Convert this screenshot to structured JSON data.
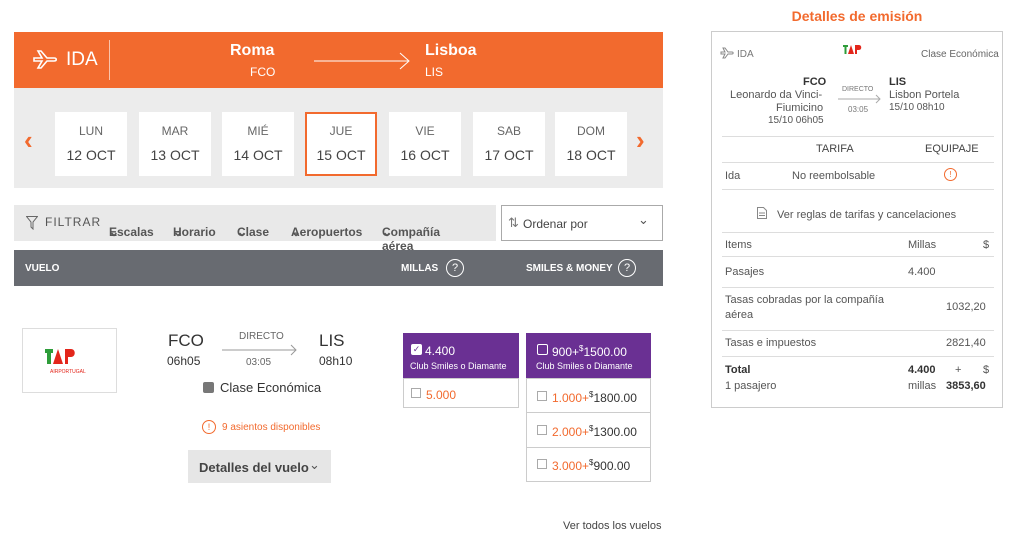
{
  "colors": {
    "accent": "#f26a2e",
    "purple": "#6a3093",
    "header_gray": "#686b71"
  },
  "ida": {
    "label": "IDA",
    "origin_city": "Roma",
    "origin_code": "FCO",
    "dest_city": "Lisboa",
    "dest_code": "LIS"
  },
  "days": [
    {
      "name": "LUN",
      "date": "12 OCT"
    },
    {
      "name": "MAR",
      "date": "13 OCT"
    },
    {
      "name": "MIÉ",
      "date": "14 OCT"
    },
    {
      "name": "JUE",
      "date": "15 OCT"
    },
    {
      "name": "VIE",
      "date": "16 OCT"
    },
    {
      "name": "SAB",
      "date": "17 OCT"
    },
    {
      "name": "DOM",
      "date": "18 OCT"
    }
  ],
  "filters": {
    "label": "FILTRAR",
    "items": [
      "Escalas",
      "Horario",
      "Clase",
      "Aeropuertos",
      "Compañía aérea"
    ]
  },
  "sort": {
    "label": "Ordenar por"
  },
  "table_header": {
    "vuelo": "VUELO",
    "millas": "MILLAS",
    "smiles": "SMILES & MONEY",
    "help": "?"
  },
  "flight": {
    "origin": "FCO",
    "origin_time": "06h05",
    "type": "DIRECTO",
    "duration": "03:05",
    "dest": "LIS",
    "dest_time": "08h10",
    "cabin": "Clase Económica",
    "seats": "9 asientos disponibles",
    "details_btn": "Detalles del vuelo",
    "airline_logo_text": "AIRPORTUGAL"
  },
  "millas": {
    "selected_value": "4.400",
    "selected_club": "Club Smiles o Diamante",
    "alt_value": "5.000"
  },
  "smiles_money": {
    "selected": {
      "miles": "900+",
      "sup": "$",
      "money": "1500.00",
      "club": "Club Smiles o Diamante"
    },
    "options": [
      {
        "miles": "1.000+",
        "sup": "$",
        "money": "1800.00"
      },
      {
        "miles": "2.000+",
        "sup": "$",
        "money": "1300.00"
      },
      {
        "miles": "3.000+",
        "sup": "$",
        "money": "900.00"
      }
    ]
  },
  "see_all": "Ver todos los vuelos",
  "emission": {
    "title": "Detalles de emisión",
    "ida": "IDA",
    "cabin": "Clase Económica",
    "origin_code": "FCO",
    "origin_name_1": "Leonardo da Vinci-",
    "origin_name_2": "Fiumicino",
    "origin_time": "15/10 06h05",
    "type": "DIRECTO",
    "duration": "03:05",
    "dest_code": "LIS",
    "dest_name": "Lisbon Portela",
    "dest_time": "15/10 08h10",
    "tarifa_h": "TARIFA",
    "equipaje_h": "EQUIPAJE",
    "tarifa_row_label": "Ida",
    "tarifa_row_value": "No reembolsable",
    "rules_link": "Ver reglas de tarifas y cancelaciones",
    "items_h": "Items",
    "millas_h": "Millas",
    "dollar_h": "$",
    "pasajes": "Pasajes",
    "pasajes_millas": "4.400",
    "tasas_comp_1": "Tasas cobradas por la compañía",
    "tasas_comp_2": "aérea",
    "tasas_comp_val": "1032,20",
    "tasas_imp": "Tasas e impuestos",
    "tasas_imp_val": "2821,40",
    "total": "Total",
    "pasajero": "1 pasajero",
    "total_millas": "4.400",
    "plus": "+",
    "total_dollar": "$",
    "millas_word": "millas",
    "total_val": "3853,60"
  }
}
